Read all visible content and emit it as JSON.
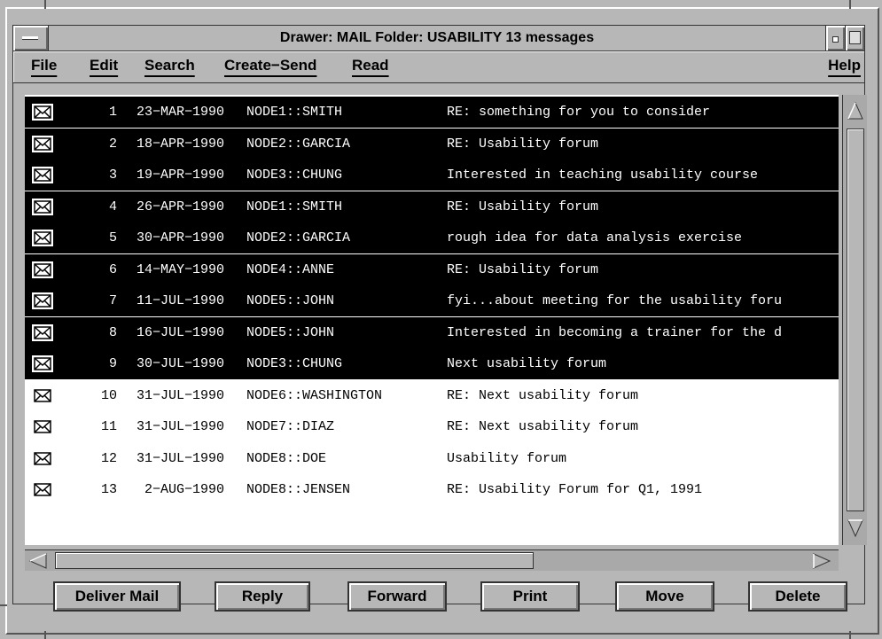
{
  "window": {
    "title": "Drawer: MAIL Folder: USABILITY 13 messages"
  },
  "menu": {
    "file": "File",
    "edit": "Edit",
    "search": "Search",
    "create_send": "Create−Send",
    "read": "Read",
    "help": "Help"
  },
  "messages": [
    {
      "num": "1",
      "date": "23−MAR−1990",
      "sender": "NODE1::SMITH",
      "subject": "RE: something for you to consider",
      "selected": true
    },
    {
      "num": "2",
      "date": "18−APR−1990",
      "sender": "NODE2::GARCIA",
      "subject": "RE: Usability forum",
      "selected": true
    },
    {
      "num": "3",
      "date": "19−APR−1990",
      "sender": "NODE3::CHUNG",
      "subject": "Interested in teaching usability course",
      "selected": true
    },
    {
      "num": "4",
      "date": "26−APR−1990",
      "sender": "NODE1::SMITH",
      "subject": "RE: Usability forum",
      "selected": true
    },
    {
      "num": "5",
      "date": "30−APR−1990",
      "sender": "NODE2::GARCIA",
      "subject": "rough idea for data analysis exercise",
      "selected": true
    },
    {
      "num": "6",
      "date": "14−MAY−1990",
      "sender": "NODE4::ANNE",
      "subject": "RE: Usability forum",
      "selected": true
    },
    {
      "num": "7",
      "date": "11−JUL−1990",
      "sender": "NODE5::JOHN",
      "subject": "fyi...about meeting for the usability foru",
      "selected": true
    },
    {
      "num": "8",
      "date": "16−JUL−1990",
      "sender": "NODE5::JOHN",
      "subject": "Interested in becoming a trainer for the d",
      "selected": true
    },
    {
      "num": "9",
      "date": "30−JUL−1990",
      "sender": "NODE3::CHUNG",
      "subject": "Next usability forum",
      "selected": true
    },
    {
      "num": "10",
      "date": "31−JUL−1990",
      "sender": "NODE6::WASHINGTON",
      "subject": "RE: Next usability forum",
      "selected": false
    },
    {
      "num": "11",
      "date": "31−JUL−1990",
      "sender": "NODE7::DIAZ",
      "subject": "RE: Next usability forum",
      "selected": false
    },
    {
      "num": "12",
      "date": "31−JUL−1990",
      "sender": "NODE8::DOE",
      "subject": "Usability forum",
      "selected": false
    },
    {
      "num": "13",
      "date": " 2−AUG−1990",
      "sender": "NODE8::JENSEN",
      "subject": "RE: Usability Forum for Q1, 1991",
      "selected": false
    }
  ],
  "buttons": {
    "deliver_mail": "Deliver Mail",
    "reply": "Reply",
    "forward": "Forward",
    "print": "Print",
    "move": "Move",
    "delete": "Delete"
  },
  "icons": {
    "message": "envelope-icon",
    "scroll_up": "arrow-up-icon",
    "scroll_down": "arrow-down-icon",
    "scroll_left": "arrow-left-icon",
    "scroll_right": "arrow-right-icon"
  }
}
